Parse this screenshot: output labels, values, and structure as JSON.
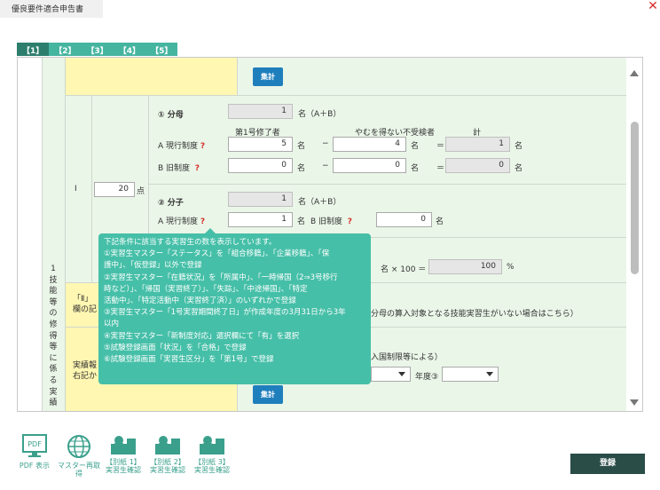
{
  "window": {
    "title": "優良要件適合申告書"
  },
  "tabs": [
    "【1】",
    "【2】",
    "【3】",
    "【4】",
    "【5】"
  ],
  "section": {
    "vertical_label": "1\n技\n能\n等\n の\n修\n得\n等\n に\n係\n る\n実\n績"
  },
  "buttons": {
    "aggregate_top": "集計",
    "aggregate_bottom": "集計",
    "register": "登録"
  },
  "row_roman": "I",
  "points": {
    "value": "20",
    "unit": "点"
  },
  "denominator": {
    "heading": "① 分母",
    "total": "1",
    "total_unit": "名（A＋B）",
    "col_header_1": "第1号修了者",
    "col_header_2": "やむを得ない不受検者",
    "col_header_3": "計",
    "row_a_label": "A 現行制度",
    "row_b_label": "B 旧制度",
    "a_completed": "5",
    "a_unavoidable": "4",
    "a_total": "1",
    "b_completed": "0",
    "b_unavoidable": "0",
    "b_total": "0",
    "unit": "名",
    "minus": "−",
    "equals": "＝"
  },
  "numerator": {
    "heading": "② 分子",
    "total": "1",
    "total_unit": "名（A＋B）",
    "row_a_label": "A 現行制度",
    "a_value": "1",
    "unit_a": "名",
    "row_b_label": "B 旧制度",
    "b_value": "0",
    "unit_b": "名"
  },
  "ratio": {
    "mult": "名 × 100 ＝",
    "value": "100",
    "unit": "%"
  },
  "note_left": "「Ⅱ」\n欄の記",
  "note_right": "分母の算入対象となる技能実習生がいない場合はこちら）",
  "record_label": "実績報\n右記か",
  "record_right": "入国制限等による）",
  "fiscal_year": "年度③",
  "tooltip": [
    "下記条件に該当する実習生の数を表示しています。",
    "①実習生マスター「ステータス」を「組合移籍」、「企業移籍」、「保",
    "護中」、「仮登録」以外で登録",
    "②実習生マスター「在籍状況」を「所属中」、「一時帰国（2⇒3号移行",
    "時など）」、「帰国（実習終了）」、「失踪」、「中途帰国」、「特定",
    "活動中」、「特定活動中（実習終了済）」のいずれかで登録",
    "③実習生マスター「1号実習期間終了日」が作成年度の3月31日から3年",
    "以内",
    "④実習生マスター「新制度対応」選択欄にて「有」を選択",
    "⑤試験登録画面「状況」を「合格」で登録",
    "⑥試験登録画面「実習生区分」を「第1号」で登録"
  ],
  "bottom_tools": [
    {
      "icon": "pdf-icon",
      "line1": "",
      "line2": "PDF 表示"
    },
    {
      "icon": "globe-icon",
      "line1": "",
      "line2": "マスター再取得"
    },
    {
      "icon": "person-card-icon",
      "line1": "【別紙 1】",
      "line2": "実習生確認"
    },
    {
      "icon": "person-card-icon",
      "line1": "【別紙 2】",
      "line2": "実習生確認"
    },
    {
      "icon": "person-card-icon",
      "line1": "【別紙 3】",
      "line2": "実習生確認"
    }
  ],
  "colors": {
    "accent": "#46bfa8",
    "tab_active": "#2d7e6d",
    "submit": "#2a4d48",
    "green_bg": "#eaf6e8",
    "yellow_bg": "#fff7b2"
  }
}
